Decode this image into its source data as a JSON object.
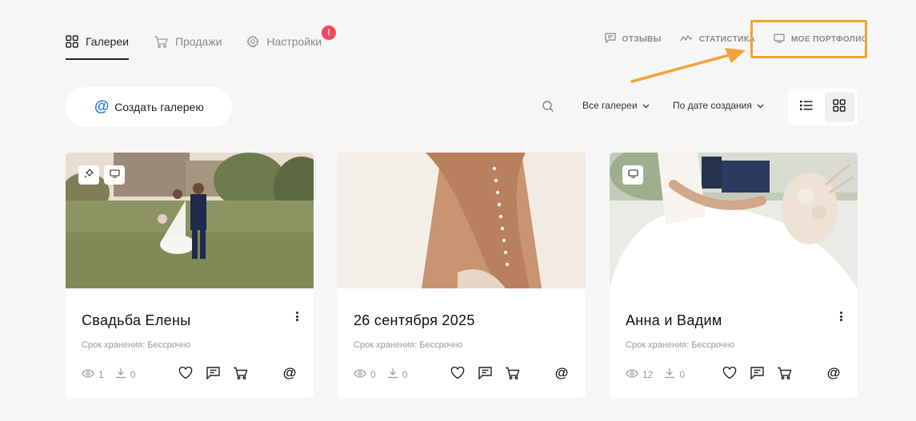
{
  "nav": {
    "tabs": [
      {
        "label": "Галереи",
        "icon": "grid-icon",
        "active": true
      },
      {
        "label": "Продажи",
        "icon": "cart-icon",
        "active": false
      },
      {
        "label": "Настройки",
        "icon": "gear-icon",
        "active": false
      }
    ],
    "settings_alert": "!",
    "links": [
      {
        "label": "ОТЗЫВЫ",
        "icon": "comment-icon"
      },
      {
        "label": "СТАТИСТИКА",
        "icon": "stats-icon"
      },
      {
        "label": "МОЕ ПОРТФОЛИО",
        "icon": "monitor-icon"
      }
    ]
  },
  "toolbar": {
    "create_label": "Создать галерею",
    "create_icon": "@",
    "filter_label": "Все галереи",
    "sort_label": "По дате создания",
    "view_modes": [
      "list-view-icon",
      "grid-view-icon"
    ],
    "active_view": "grid"
  },
  "annotation": {
    "highlight_color": "#f3a13c"
  },
  "colors": {
    "accent": "#1b7cd9",
    "alert": "#f2485a"
  },
  "galleries": [
    {
      "title": "Свадьба Елены",
      "storage": "Срок хранения: Бессрочно",
      "views": "1",
      "downloads": "0",
      "badges": [
        "pin-icon",
        "monitor-icon"
      ],
      "show_menu": true
    },
    {
      "title": "26 сентября 2025",
      "storage": "Срок хранения: Бессрочно",
      "views": "0",
      "downloads": "0",
      "badges": [],
      "show_menu": false
    },
    {
      "title": "Анна и Вадим",
      "storage": "Срок хранения: Бессрочно",
      "views": "12",
      "downloads": "0",
      "badges": [
        "monitor-icon"
      ],
      "show_menu": true
    }
  ],
  "card_actions": [
    "heart-icon",
    "comment-icon",
    "cart-icon",
    "at-icon"
  ],
  "at_symbol": "@"
}
